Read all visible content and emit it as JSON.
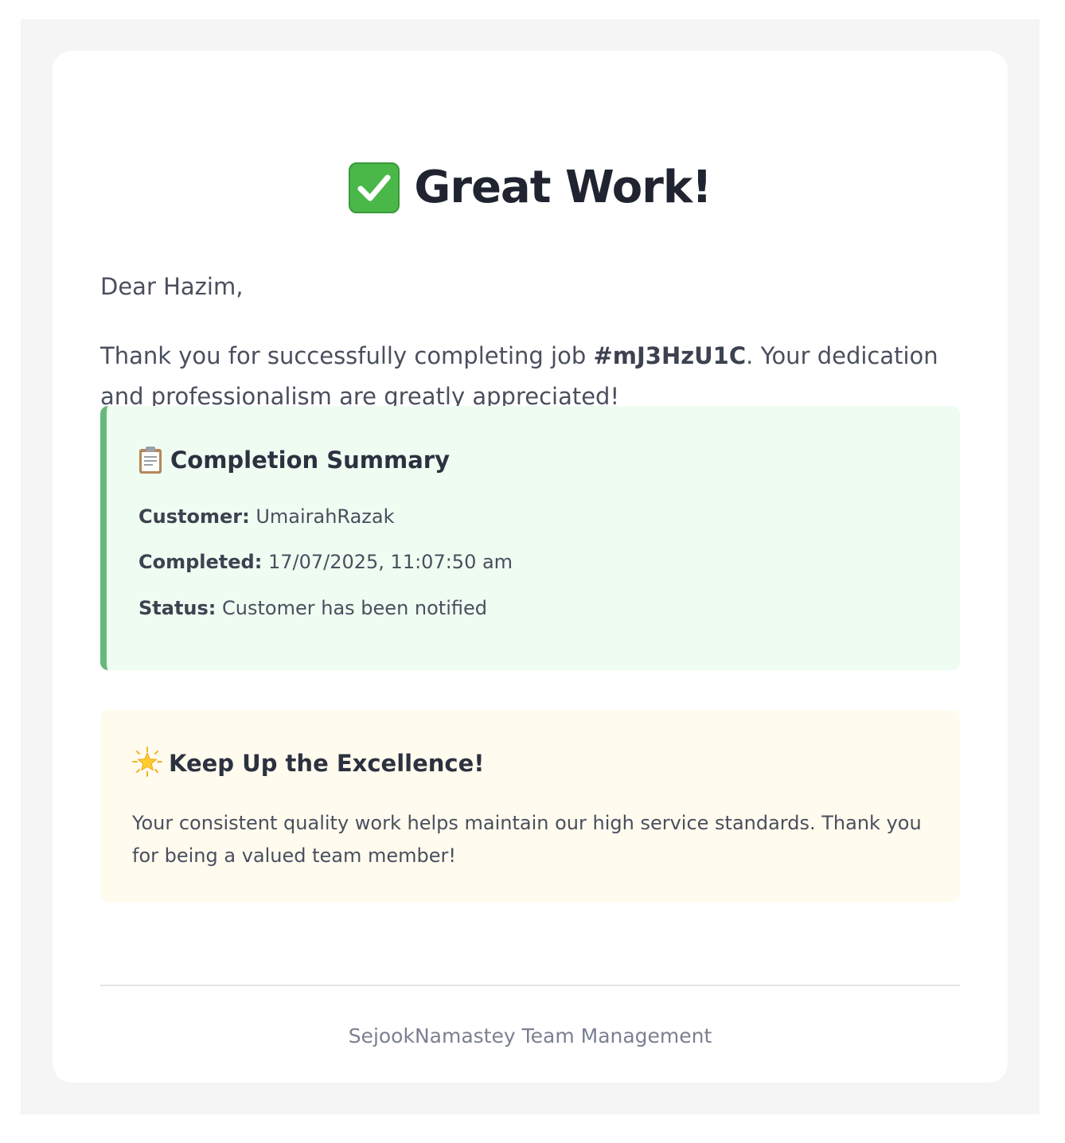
{
  "header": {
    "icon": "check-mark-icon",
    "title": "Great Work!"
  },
  "greeting": "Dear Hazim,",
  "message": {
    "before": "Thank you for successfully completing job ",
    "job_id": "#mJ3HzU1C",
    "after": ". Your dedication and professionalism are greatly appreciated!"
  },
  "summary": {
    "icon": "clipboard-icon",
    "title": "Completion Summary",
    "rows": [
      {
        "label": "Customer:",
        "value": "UmairahRazak"
      },
      {
        "label": "Completed:",
        "value": "17/07/2025, 11:07:50 am"
      },
      {
        "label": "Status:",
        "value": "Customer has been notified"
      }
    ]
  },
  "excellence": {
    "icon": "star-icon",
    "title": "Keep Up the Excellence!",
    "text": "Your consistent quality work helps maintain our high service standards. Thank you for being a valued team member!"
  },
  "footer": {
    "text": "SejookNamastey Team Management"
  },
  "colors": {
    "page_background": "#f5f5f5",
    "summary_background": "#effcf1",
    "summary_accent": "#68b87a",
    "excellence_background": "#fffbee",
    "check_green": "#49b849"
  }
}
